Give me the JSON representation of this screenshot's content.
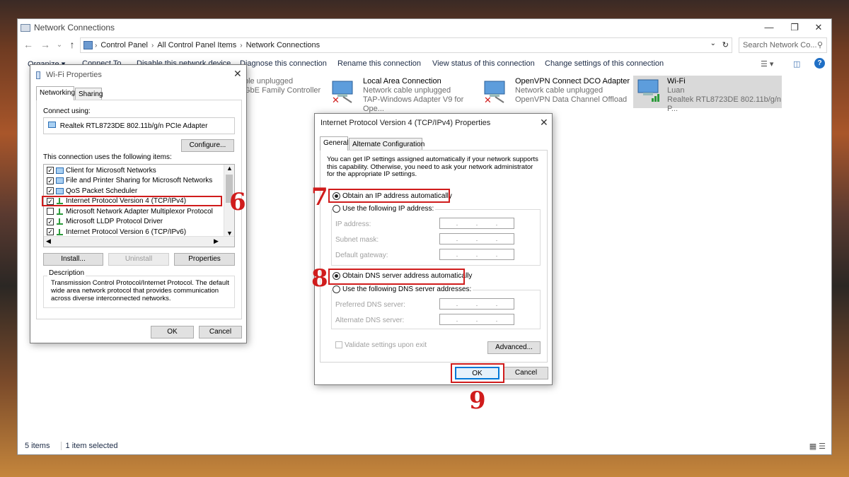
{
  "explorer": {
    "title": "Network Connections",
    "breadcrumb": [
      "Control Panel",
      "All Control Panel Items",
      "Network Connections"
    ],
    "search_placeholder": "Search Network Co...",
    "commands": {
      "organize": "Organize",
      "connect_to": "Connect To",
      "disable": "Disable this network device",
      "diagnose": "Diagnose this connection",
      "rename": "Rename this connection",
      "view_status": "View status of this connection",
      "change_settings": "Change settings of this connection"
    },
    "connections": [
      {
        "name": "",
        "status": "ble unplugged",
        "device": "GbE Family Controller"
      },
      {
        "name": "Local Area Connection",
        "status": "Network cable unplugged",
        "device": "TAP-Windows Adapter V9 for Ope..."
      },
      {
        "name": "OpenVPN Connect DCO Adapter",
        "status": "Network cable unplugged",
        "device": "OpenVPN Data Channel Offload"
      },
      {
        "name": "Wi-Fi",
        "status": "Luan",
        "device": "Realtek RTL8723DE 802.11b/g/n P..."
      }
    ],
    "status": {
      "items": "5 items",
      "selected": "1 item selected"
    }
  },
  "wifi_dialog": {
    "title": "Wi-Fi Properties",
    "tabs": [
      "Networking",
      "Sharing"
    ],
    "connect_using_label": "Connect using:",
    "adapter": "Realtek RTL8723DE 802.11b/g/n PCIe Adapter",
    "configure": "Configure...",
    "items_label": "This connection uses the following items:",
    "items": [
      {
        "label": "Client for Microsoft Networks",
        "checked": true
      },
      {
        "label": "File and Printer Sharing for Microsoft Networks",
        "checked": true
      },
      {
        "label": "QoS Packet Scheduler",
        "checked": true
      },
      {
        "label": "Internet Protocol Version 4 (TCP/IPv4)",
        "checked": true
      },
      {
        "label": "Microsoft Network Adapter Multiplexor Protocol",
        "checked": false
      },
      {
        "label": "Microsoft LLDP Protocol Driver",
        "checked": true
      },
      {
        "label": "Internet Protocol Version 6 (TCP/IPv6)",
        "checked": true
      }
    ],
    "install": "Install...",
    "uninstall": "Uninstall",
    "properties": "Properties",
    "description_label": "Description",
    "description": "Transmission Control Protocol/Internet Protocol. The default wide area network protocol that provides communication across diverse interconnected networks.",
    "ok": "OK",
    "cancel": "Cancel"
  },
  "ipv4_dialog": {
    "title": "Internet Protocol Version 4 (TCP/IPv4) Properties",
    "tabs": [
      "General",
      "Alternate Configuration"
    ],
    "intro": "You can get IP settings assigned automatically if your network supports this capability. Otherwise, you need to ask your network administrator for the appropriate IP settings.",
    "obtain_ip_auto": "Obtain an IP address automatically",
    "use_following_ip": "Use the following IP address:",
    "ip_address": "IP address:",
    "subnet_mask": "Subnet mask:",
    "default_gateway": "Default gateway:",
    "obtain_dns_auto": "Obtain DNS server address automatically",
    "use_following_dns": "Use the following DNS server addresses:",
    "preferred_dns": "Preferred DNS server:",
    "alternate_dns": "Alternate DNS server:",
    "validate": "Validate settings upon exit",
    "advanced": "Advanced...",
    "ok": "OK",
    "cancel": "Cancel",
    "ip_placeholder": ".       .       ."
  },
  "annotations": {
    "step6": "6",
    "step7": "7",
    "step8": "8",
    "step9": "9"
  },
  "colors": {
    "highlight": "#d01c1c",
    "link_text": "#1b2a45"
  }
}
